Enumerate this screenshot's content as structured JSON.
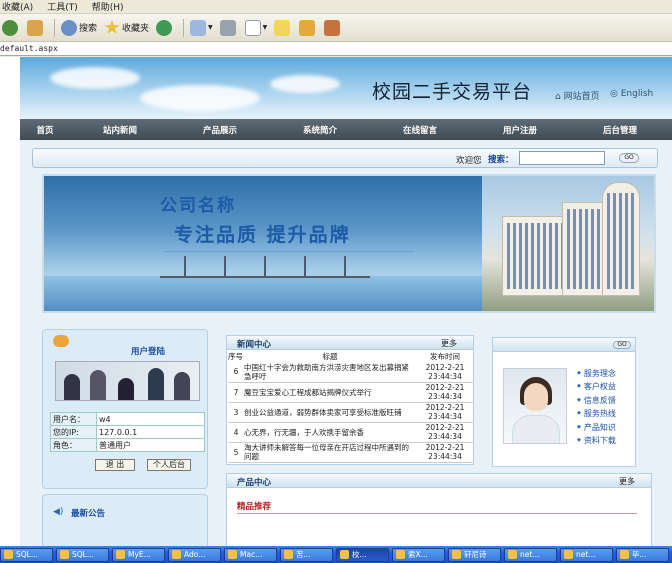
{
  "menubar": {
    "items": [
      "收藏(A)",
      "工具(T)",
      "帮助(H)"
    ]
  },
  "toolbar": {
    "search_label": "搜索",
    "favorites_label": "收藏夹"
  },
  "address": {
    "url": "default.aspx"
  },
  "site": {
    "title": "校园二手交易平台",
    "home_link": "网站首页",
    "english_link": "English"
  },
  "nav": {
    "items": [
      "首页",
      "站内新闻",
      "产品展示",
      "系统简介",
      "在线留言",
      "用户注册",
      "后台管理"
    ]
  },
  "searchbar": {
    "welcome": "欢迎您",
    "search_label": "搜索：",
    "search_value": "",
    "go_label": "GO"
  },
  "hero": {
    "company": "公司名称",
    "slogan": "专注品质 提升品牌"
  },
  "login": {
    "title": "用户登陆",
    "rows": [
      {
        "label": "用户名：",
        "value": "w4"
      },
      {
        "label": "您的IP:",
        "value": "127.0.0.1"
      },
      {
        "label": "角色：",
        "value": "普通用户"
      }
    ],
    "logout_button": "退 出",
    "backend_button": "个人后台"
  },
  "notice": {
    "title": "最新公告"
  },
  "news": {
    "title": "新闻中心",
    "more": "更多",
    "headers": [
      "序号",
      "标题",
      "发布时间"
    ],
    "rows": [
      {
        "no": "6",
        "title": "中国红十字会为救助南方洪涝灾害地区发出募捐紧急呼吁",
        "date": "2012-2-21 23:44:34"
      },
      {
        "no": "7",
        "title": "魔豆宝宝爱心工程成都站揭牌仪式举行",
        "date": "2012-2-21 23:44:34"
      },
      {
        "no": "3",
        "title": "创业公益通道，弱势群体卖家可享受标准版旺铺",
        "date": "2012-2-21 23:44:34"
      },
      {
        "no": "4",
        "title": "心无界，行无疆，于人欢携手留余香",
        "date": "2012-2-21 23:44:34"
      },
      {
        "no": "5",
        "title": "淘大讲师未解答每一位母亲在开店过程中所遇到的问题",
        "date": "2012-2-21 23:44:34"
      }
    ]
  },
  "products": {
    "title": "产品中心",
    "more": "更多",
    "subtitle": "精品推荐"
  },
  "service": {
    "go_label": "GO",
    "items": [
      "服务理念",
      "客户权益",
      "信息反馈",
      "服务热线",
      "产品知识",
      "资料下载"
    ]
  },
  "taskbar": {
    "items": [
      "SQL...",
      "SQL...",
      "MyE...",
      "Ado...",
      "Mac...",
      "苦...",
      "校...",
      "索X...",
      "轩尼诗",
      "net...",
      "net...",
      "毕..."
    ]
  }
}
